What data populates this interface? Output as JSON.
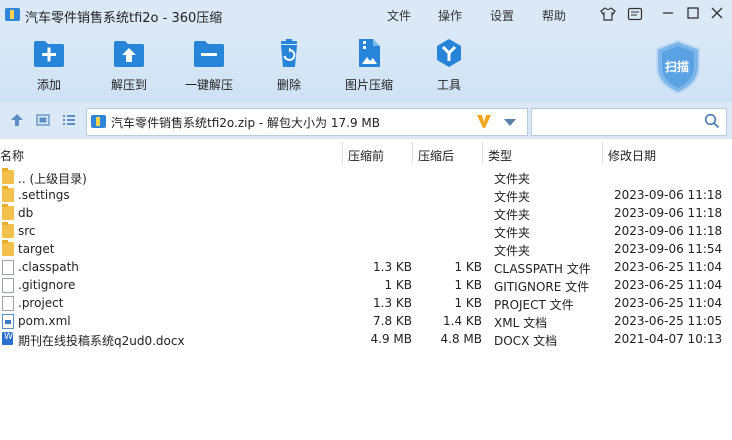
{
  "window": {
    "title": "汽车零件销售系统tfi2o - 360压缩",
    "menu": [
      "文件",
      "操作",
      "设置",
      "帮助"
    ]
  },
  "toolbar": {
    "items": [
      {
        "label": "添加",
        "icon": "add-icon"
      },
      {
        "label": "解压到",
        "icon": "extract-to-icon"
      },
      {
        "label": "一键解压",
        "icon": "one-click-extract-icon"
      },
      {
        "label": "删除",
        "icon": "delete-icon"
      },
      {
        "label": "图片压缩",
        "icon": "image-compress-icon"
      },
      {
        "label": "工具",
        "icon": "tools-icon"
      }
    ],
    "scan_label": "扫描"
  },
  "address": {
    "path": "汽车零件销售系统tfi2o.zip - 解包大小为 17.9 MB"
  },
  "columns": [
    "名称",
    "压缩前",
    "压缩后",
    "类型",
    "修改日期"
  ],
  "files": [
    {
      "name": ".. (上级目录)",
      "csize": "",
      "psize": "",
      "type": "文件夹",
      "date": "",
      "kind": "folder"
    },
    {
      "name": ".settings",
      "csize": "",
      "psize": "",
      "type": "文件夹",
      "date": "2023-09-06 11:18",
      "kind": "folder"
    },
    {
      "name": "db",
      "csize": "",
      "psize": "",
      "type": "文件夹",
      "date": "2023-09-06 11:18",
      "kind": "folder"
    },
    {
      "name": "src",
      "csize": "",
      "psize": "",
      "type": "文件夹",
      "date": "2023-09-06 11:18",
      "kind": "folder"
    },
    {
      "name": "target",
      "csize": "",
      "psize": "",
      "type": "文件夹",
      "date": "2023-09-06 11:54",
      "kind": "folder"
    },
    {
      "name": ".classpath",
      "csize": "1.3 KB",
      "psize": "1 KB",
      "type": "CLASSPATH 文件",
      "date": "2023-06-25 11:04",
      "kind": "file"
    },
    {
      "name": ".gitignore",
      "csize": "1 KB",
      "psize": "1 KB",
      "type": "GITIGNORE 文件",
      "date": "2023-06-25 11:04",
      "kind": "file"
    },
    {
      "name": ".project",
      "csize": "1.3 KB",
      "psize": "1 KB",
      "type": "PROJECT 文件",
      "date": "2023-06-25 11:04",
      "kind": "file"
    },
    {
      "name": "pom.xml",
      "csize": "7.8 KB",
      "psize": "1.4 KB",
      "type": "XML 文档",
      "date": "2023-06-25 11:05",
      "kind": "xml"
    },
    {
      "name": "期刊在线投稿系统q2ud0.docx",
      "csize": "4.9 MB",
      "psize": "4.8 MB",
      "type": "DOCX 文档",
      "date": "2021-04-07 10:13",
      "kind": "docx"
    }
  ]
}
